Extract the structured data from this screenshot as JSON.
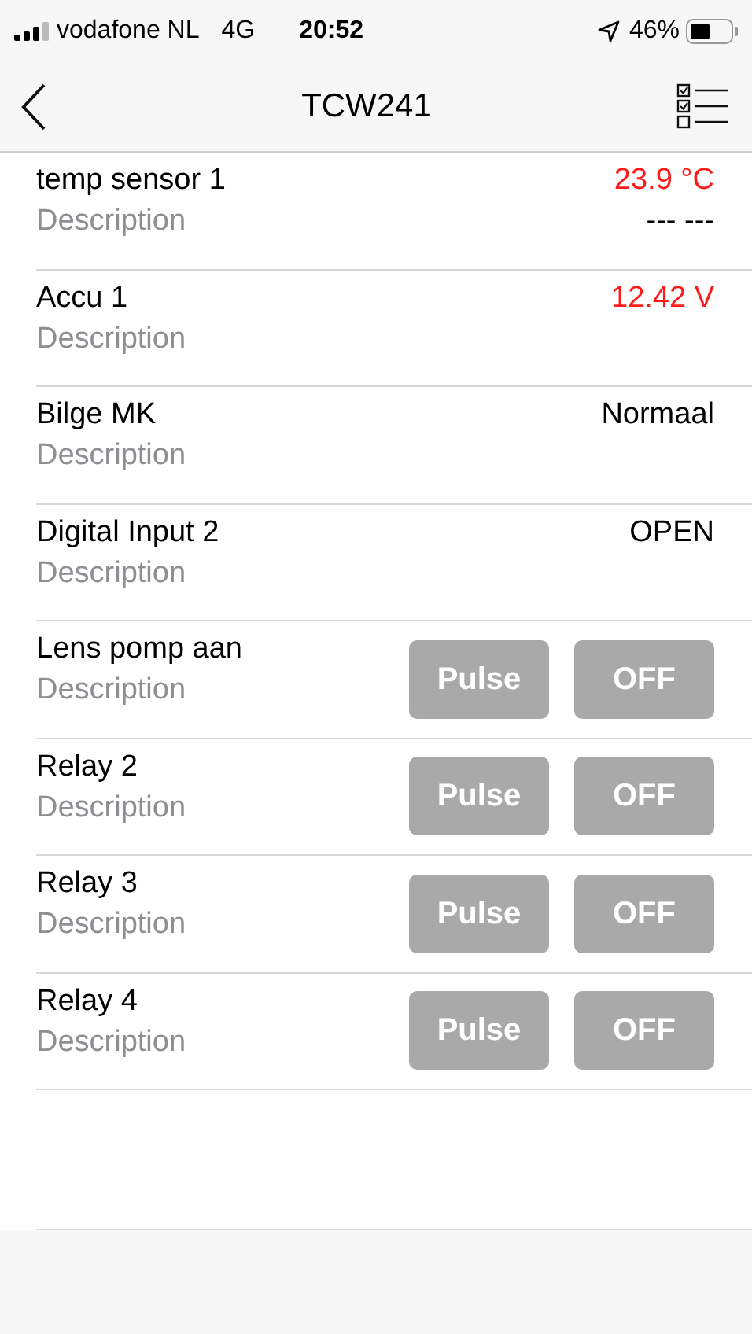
{
  "status_bar": {
    "carrier": "vodafone NL",
    "network": "4G",
    "time": "20:52",
    "battery": "46%"
  },
  "nav": {
    "title": "TCW241"
  },
  "rows": [
    {
      "kind": "reading",
      "name": "temp sensor 1",
      "description": "Description",
      "value": "23.9 °C",
      "color": "#ff1a1a",
      "value_2": "--- ---"
    },
    {
      "kind": "reading",
      "name": "Accu 1",
      "description": "Description",
      "value": "12.42 V",
      "color": "#ff1a1a"
    },
    {
      "kind": "reading",
      "name": "Bilge MK",
      "description": "Description",
      "value": "Normaal",
      "color": "#000000"
    },
    {
      "kind": "reading",
      "name": "Digital Input 2",
      "description": "Description",
      "value": "OPEN",
      "color": "#000000"
    },
    {
      "kind": "relay",
      "name": "Lens pomp aan",
      "description": "Description",
      "buttons": [
        "Pulse",
        "OFF"
      ]
    },
    {
      "kind": "relay",
      "name": "Relay 2",
      "description": "Description",
      "buttons": [
        "Pulse",
        "OFF"
      ]
    },
    {
      "kind": "relay",
      "name": "Relay 3",
      "description": "Description",
      "buttons": [
        "Pulse",
        "OFF"
      ]
    },
    {
      "kind": "relay",
      "name": "Relay 4",
      "description": "Description",
      "buttons": [
        "Pulse",
        "OFF"
      ]
    }
  ]
}
